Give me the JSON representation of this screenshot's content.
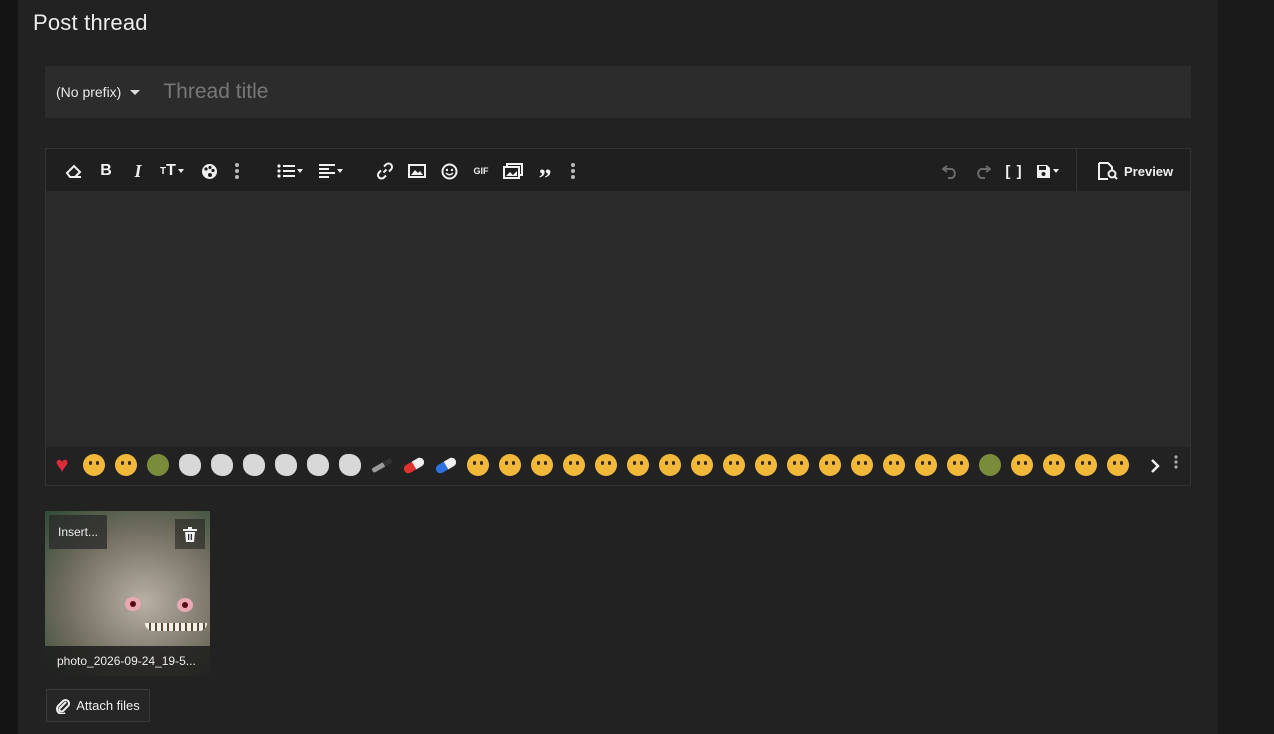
{
  "page": {
    "title": "Post thread"
  },
  "thread_form": {
    "prefix_label": "(No prefix)",
    "title_placeholder": "Thread title",
    "title_value": ""
  },
  "toolbar": {
    "left_buttons": [
      "eraser-icon",
      "bold-icon",
      "italic-icon",
      "text-size-icon",
      "palette-icon",
      "more-vertical-icon",
      "list-icon",
      "align-icon",
      "link-icon",
      "image-icon",
      "smiley-icon",
      "gif-icon",
      "media-icon",
      "quote-icon",
      "more-vertical-icon"
    ],
    "right_buttons": [
      "undo-icon",
      "redo-icon",
      "brackets-icon",
      "save-draft-icon"
    ],
    "preview_label": "Preview",
    "gif_label": "GIF"
  },
  "emoji_bar": {
    "items": [
      "heart",
      "tears-of-joy",
      "rolling-on-floor",
      "shrek",
      "rage-face",
      "wojak",
      "wojak",
      "wojak",
      "wojak",
      "wojak",
      "knife",
      "red-pill",
      "blue-pill",
      "grin",
      "smile",
      "tongue",
      "grinning",
      "laughing",
      "rolling-on-floor",
      "tears-of-joy",
      "star-struck",
      "wink",
      "frown",
      "confused",
      "worried",
      "unamused",
      "smirk",
      "raised-eyebrow",
      "thinking",
      "pepe",
      "kissing",
      "scream",
      "flushed",
      "rolling-eyes"
    ]
  },
  "attachment": {
    "insert_label": "Insert...",
    "file_name": "photo_2026-09-24_19-5..."
  },
  "attach_files_label": "Attach files",
  "colors": {
    "panel": "#222222",
    "input": "#2c2c2c",
    "editor": "#2a2a2a",
    "heart": "#e0293b"
  }
}
